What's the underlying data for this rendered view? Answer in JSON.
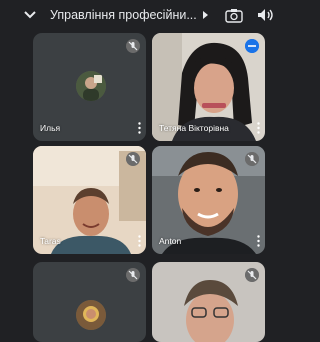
{
  "header": {
    "title": "Управління професійни...",
    "icons": [
      "chevron-down-icon",
      "caret-right-icon",
      "camera-switch-icon",
      "speaker-icon"
    ]
  },
  "participants": [
    {
      "name": "Илья",
      "status_icon": "mic-off-icon",
      "video": false
    },
    {
      "name": "Тетяна Вікторівна",
      "status_icon": "speaking-indicator-icon",
      "video": true
    },
    {
      "name": "Taras",
      "status_icon": "mic-off-icon",
      "video": true
    },
    {
      "name": "Anton",
      "status_icon": "mic-off-icon",
      "video": true
    },
    {
      "name": "",
      "status_icon": "mic-off-icon",
      "video": false
    },
    {
      "name": "",
      "status_icon": "mic-off-icon",
      "video": true
    }
  ],
  "colors": {
    "background": "#202124",
    "tile": "#3c4043",
    "speaking": "#1a73e8"
  }
}
